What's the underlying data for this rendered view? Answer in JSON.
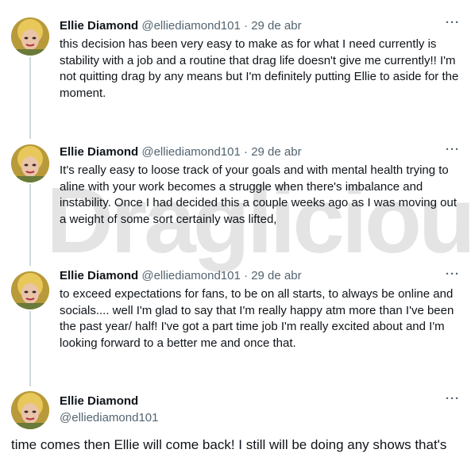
{
  "watermark": "Draglicious",
  "tweets": [
    {
      "name": "Ellie Diamond",
      "handle": "@elliediamond101",
      "separator": "·",
      "date": "29 de abr",
      "more": "···",
      "text": "this decision has been very easy to make as for what I need currently is stability with a job and a routine that drag life doesn't give me currently!! I'm not quitting drag by any means but I'm definitely putting Ellie to aside for the moment."
    },
    {
      "name": "Ellie Diamond",
      "handle": "@elliediamond101",
      "separator": "·",
      "date": "29 de abr",
      "more": "···",
      "text": "It's really easy to loose track of your goals and with mental health trying to aline with your work becomes a struggle when there's imbalance and instability. Once I had decided this a couple weeks ago as I was moving out a weight of some sort certainly was lifted,"
    },
    {
      "name": "Ellie Diamond",
      "handle": "@elliediamond101",
      "separator": "·",
      "date": "29 de abr",
      "more": "···",
      "text": "to exceed expectations for fans, to be on all starts, to always be online and socials.... well I'm glad to say that I'm really happy atm more than I've been the past year/ half! I've got a part time job I'm really excited about and I'm looking forward to a better me and once that."
    }
  ],
  "profile": {
    "name": "Ellie Diamond",
    "handle": "@elliediamond101",
    "more": "···"
  },
  "bottom_text": "time comes then Ellie will come back! I still will be doing any shows that's"
}
